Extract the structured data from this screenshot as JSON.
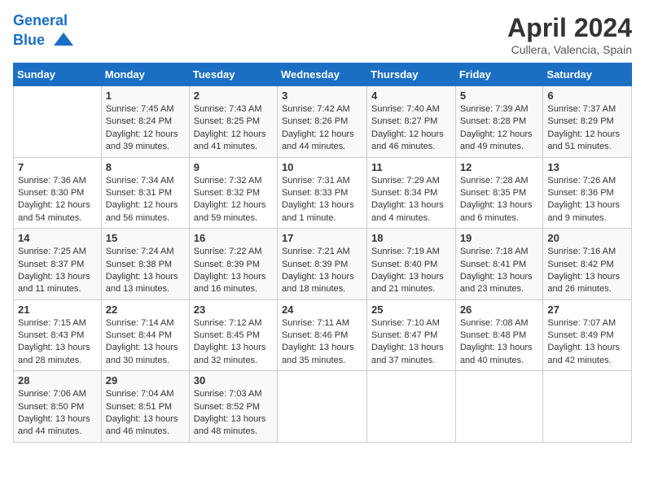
{
  "logo": {
    "line1": "General",
    "line2": "Blue"
  },
  "title": "April 2024",
  "subtitle": "Cullera, Valencia, Spain",
  "days_of_week": [
    "Sunday",
    "Monday",
    "Tuesday",
    "Wednesday",
    "Thursday",
    "Friday",
    "Saturday"
  ],
  "weeks": [
    [
      {
        "day": "",
        "sunrise": "",
        "sunset": "",
        "daylight": ""
      },
      {
        "day": "1",
        "sunrise": "Sunrise: 7:45 AM",
        "sunset": "Sunset: 8:24 PM",
        "daylight": "Daylight: 12 hours and 39 minutes."
      },
      {
        "day": "2",
        "sunrise": "Sunrise: 7:43 AM",
        "sunset": "Sunset: 8:25 PM",
        "daylight": "Daylight: 12 hours and 41 minutes."
      },
      {
        "day": "3",
        "sunrise": "Sunrise: 7:42 AM",
        "sunset": "Sunset: 8:26 PM",
        "daylight": "Daylight: 12 hours and 44 minutes."
      },
      {
        "day": "4",
        "sunrise": "Sunrise: 7:40 AM",
        "sunset": "Sunset: 8:27 PM",
        "daylight": "Daylight: 12 hours and 46 minutes."
      },
      {
        "day": "5",
        "sunrise": "Sunrise: 7:39 AM",
        "sunset": "Sunset: 8:28 PM",
        "daylight": "Daylight: 12 hours and 49 minutes."
      },
      {
        "day": "6",
        "sunrise": "Sunrise: 7:37 AM",
        "sunset": "Sunset: 8:29 PM",
        "daylight": "Daylight: 12 hours and 51 minutes."
      }
    ],
    [
      {
        "day": "7",
        "sunrise": "Sunrise: 7:36 AM",
        "sunset": "Sunset: 8:30 PM",
        "daylight": "Daylight: 12 hours and 54 minutes."
      },
      {
        "day": "8",
        "sunrise": "Sunrise: 7:34 AM",
        "sunset": "Sunset: 8:31 PM",
        "daylight": "Daylight: 12 hours and 56 minutes."
      },
      {
        "day": "9",
        "sunrise": "Sunrise: 7:32 AM",
        "sunset": "Sunset: 8:32 PM",
        "daylight": "Daylight: 12 hours and 59 minutes."
      },
      {
        "day": "10",
        "sunrise": "Sunrise: 7:31 AM",
        "sunset": "Sunset: 8:33 PM",
        "daylight": "Daylight: 13 hours and 1 minute."
      },
      {
        "day": "11",
        "sunrise": "Sunrise: 7:29 AM",
        "sunset": "Sunset: 8:34 PM",
        "daylight": "Daylight: 13 hours and 4 minutes."
      },
      {
        "day": "12",
        "sunrise": "Sunrise: 7:28 AM",
        "sunset": "Sunset: 8:35 PM",
        "daylight": "Daylight: 13 hours and 6 minutes."
      },
      {
        "day": "13",
        "sunrise": "Sunrise: 7:26 AM",
        "sunset": "Sunset: 8:36 PM",
        "daylight": "Daylight: 13 hours and 9 minutes."
      }
    ],
    [
      {
        "day": "14",
        "sunrise": "Sunrise: 7:25 AM",
        "sunset": "Sunset: 8:37 PM",
        "daylight": "Daylight: 13 hours and 11 minutes."
      },
      {
        "day": "15",
        "sunrise": "Sunrise: 7:24 AM",
        "sunset": "Sunset: 8:38 PM",
        "daylight": "Daylight: 13 hours and 13 minutes."
      },
      {
        "day": "16",
        "sunrise": "Sunrise: 7:22 AM",
        "sunset": "Sunset: 8:39 PM",
        "daylight": "Daylight: 13 hours and 16 minutes."
      },
      {
        "day": "17",
        "sunrise": "Sunrise: 7:21 AM",
        "sunset": "Sunset: 8:39 PM",
        "daylight": "Daylight: 13 hours and 18 minutes."
      },
      {
        "day": "18",
        "sunrise": "Sunrise: 7:19 AM",
        "sunset": "Sunset: 8:40 PM",
        "daylight": "Daylight: 13 hours and 21 minutes."
      },
      {
        "day": "19",
        "sunrise": "Sunrise: 7:18 AM",
        "sunset": "Sunset: 8:41 PM",
        "daylight": "Daylight: 13 hours and 23 minutes."
      },
      {
        "day": "20",
        "sunrise": "Sunrise: 7:16 AM",
        "sunset": "Sunset: 8:42 PM",
        "daylight": "Daylight: 13 hours and 26 minutes."
      }
    ],
    [
      {
        "day": "21",
        "sunrise": "Sunrise: 7:15 AM",
        "sunset": "Sunset: 8:43 PM",
        "daylight": "Daylight: 13 hours and 28 minutes."
      },
      {
        "day": "22",
        "sunrise": "Sunrise: 7:14 AM",
        "sunset": "Sunset: 8:44 PM",
        "daylight": "Daylight: 13 hours and 30 minutes."
      },
      {
        "day": "23",
        "sunrise": "Sunrise: 7:12 AM",
        "sunset": "Sunset: 8:45 PM",
        "daylight": "Daylight: 13 hours and 32 minutes."
      },
      {
        "day": "24",
        "sunrise": "Sunrise: 7:11 AM",
        "sunset": "Sunset: 8:46 PM",
        "daylight": "Daylight: 13 hours and 35 minutes."
      },
      {
        "day": "25",
        "sunrise": "Sunrise: 7:10 AM",
        "sunset": "Sunset: 8:47 PM",
        "daylight": "Daylight: 13 hours and 37 minutes."
      },
      {
        "day": "26",
        "sunrise": "Sunrise: 7:08 AM",
        "sunset": "Sunset: 8:48 PM",
        "daylight": "Daylight: 13 hours and 40 minutes."
      },
      {
        "day": "27",
        "sunrise": "Sunrise: 7:07 AM",
        "sunset": "Sunset: 8:49 PM",
        "daylight": "Daylight: 13 hours and 42 minutes."
      }
    ],
    [
      {
        "day": "28",
        "sunrise": "Sunrise: 7:06 AM",
        "sunset": "Sunset: 8:50 PM",
        "daylight": "Daylight: 13 hours and 44 minutes."
      },
      {
        "day": "29",
        "sunrise": "Sunrise: 7:04 AM",
        "sunset": "Sunset: 8:51 PM",
        "daylight": "Daylight: 13 hours and 46 minutes."
      },
      {
        "day": "30",
        "sunrise": "Sunrise: 7:03 AM",
        "sunset": "Sunset: 8:52 PM",
        "daylight": "Daylight: 13 hours and 48 minutes."
      },
      {
        "day": "",
        "sunrise": "",
        "sunset": "",
        "daylight": ""
      },
      {
        "day": "",
        "sunrise": "",
        "sunset": "",
        "daylight": ""
      },
      {
        "day": "",
        "sunrise": "",
        "sunset": "",
        "daylight": ""
      },
      {
        "day": "",
        "sunrise": "",
        "sunset": "",
        "daylight": ""
      }
    ]
  ]
}
